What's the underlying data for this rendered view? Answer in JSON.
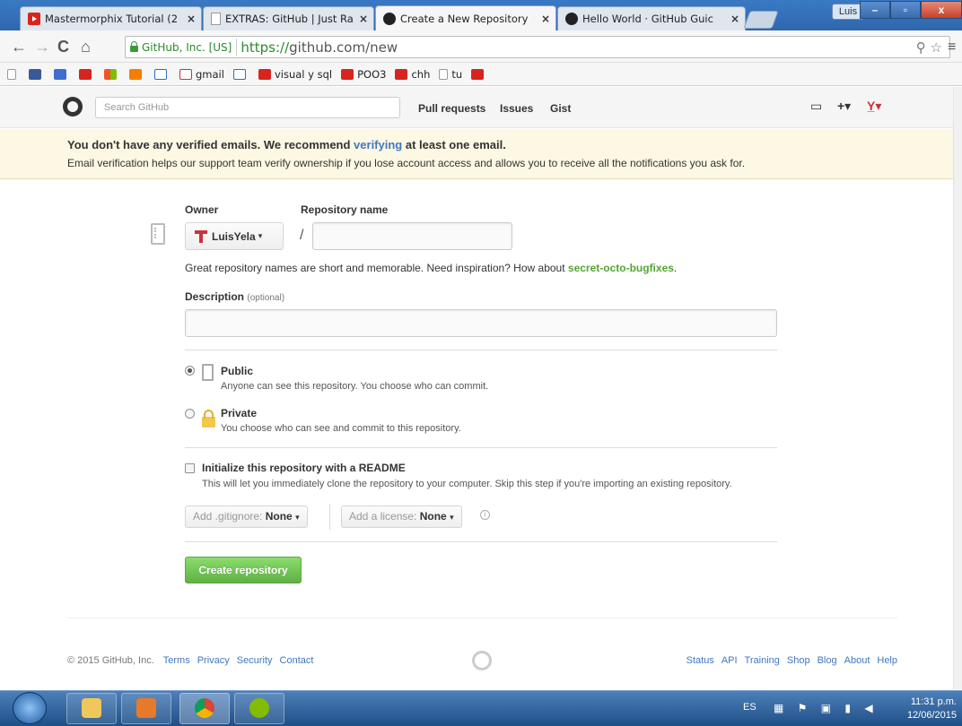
{
  "browser": {
    "tabs": [
      {
        "title": "Mastermorphix Tutorial (2",
        "favicon": "youtube-icon"
      },
      {
        "title": "EXTRAS: GitHub | Just Ran",
        "favicon": "document-icon"
      },
      {
        "title": "Create a New Repository",
        "favicon": "github-icon"
      },
      {
        "title": "Hello World · GitHub Guic",
        "favicon": "github-icon"
      }
    ],
    "user_badge": "Luis",
    "address": {
      "ev_label": "GitHub, Inc. [US]",
      "scheme": "https://",
      "host": "github.com",
      "path": "/new"
    },
    "bookmarks": [
      {
        "label": "gmail"
      },
      {
        "label": "visual y sql"
      },
      {
        "label": "POO3"
      },
      {
        "label": "chh"
      },
      {
        "label": "tu"
      }
    ]
  },
  "github": {
    "search_placeholder": "Search GitHub",
    "nav": {
      "pulls": "Pull requests",
      "issues": "Issues",
      "gist": "Gist"
    }
  },
  "flash": {
    "line1_before": "You don't have any verified emails. We recommend ",
    "line1_link": "verifying",
    "line1_after": " at least one email.",
    "line2": "Email verification helps our support team verify ownership if you lose account access and allows you to receive all the notifications you ask for."
  },
  "form": {
    "owner_label": "Owner",
    "repo_name_label": "Repository name",
    "owner_value": "LuisYela",
    "slash": "/",
    "hint_before": "Great repository names are short and memorable. Need inspiration? How about ",
    "hint_suggestion": "secret-octo-bugfixes",
    "hint_after": ".",
    "description_label": "Description",
    "description_optional": "(optional)",
    "public_title": "Public",
    "public_desc": "Anyone can see this repository. You choose who can commit.",
    "private_title": "Private",
    "private_desc": "You choose who can see and commit to this repository.",
    "readme_title": "Initialize this repository with a README",
    "readme_desc": "This will let you immediately clone the repository to your computer. Skip this step if you're importing an existing repository.",
    "gitignore_label": "Add .gitignore:",
    "gitignore_value": "None",
    "license_label": "Add a license:",
    "license_value": "None",
    "create_button": "Create repository"
  },
  "footer": {
    "copyright": "© 2015 GitHub, Inc.",
    "left_links": [
      "Terms",
      "Privacy",
      "Security",
      "Contact"
    ],
    "right_links": [
      "Status",
      "API",
      "Training",
      "Shop",
      "Blog",
      "About",
      "Help"
    ]
  },
  "taskbar": {
    "lang": "ES",
    "time": "11:31 p.m.",
    "date": "12/06/2015"
  }
}
